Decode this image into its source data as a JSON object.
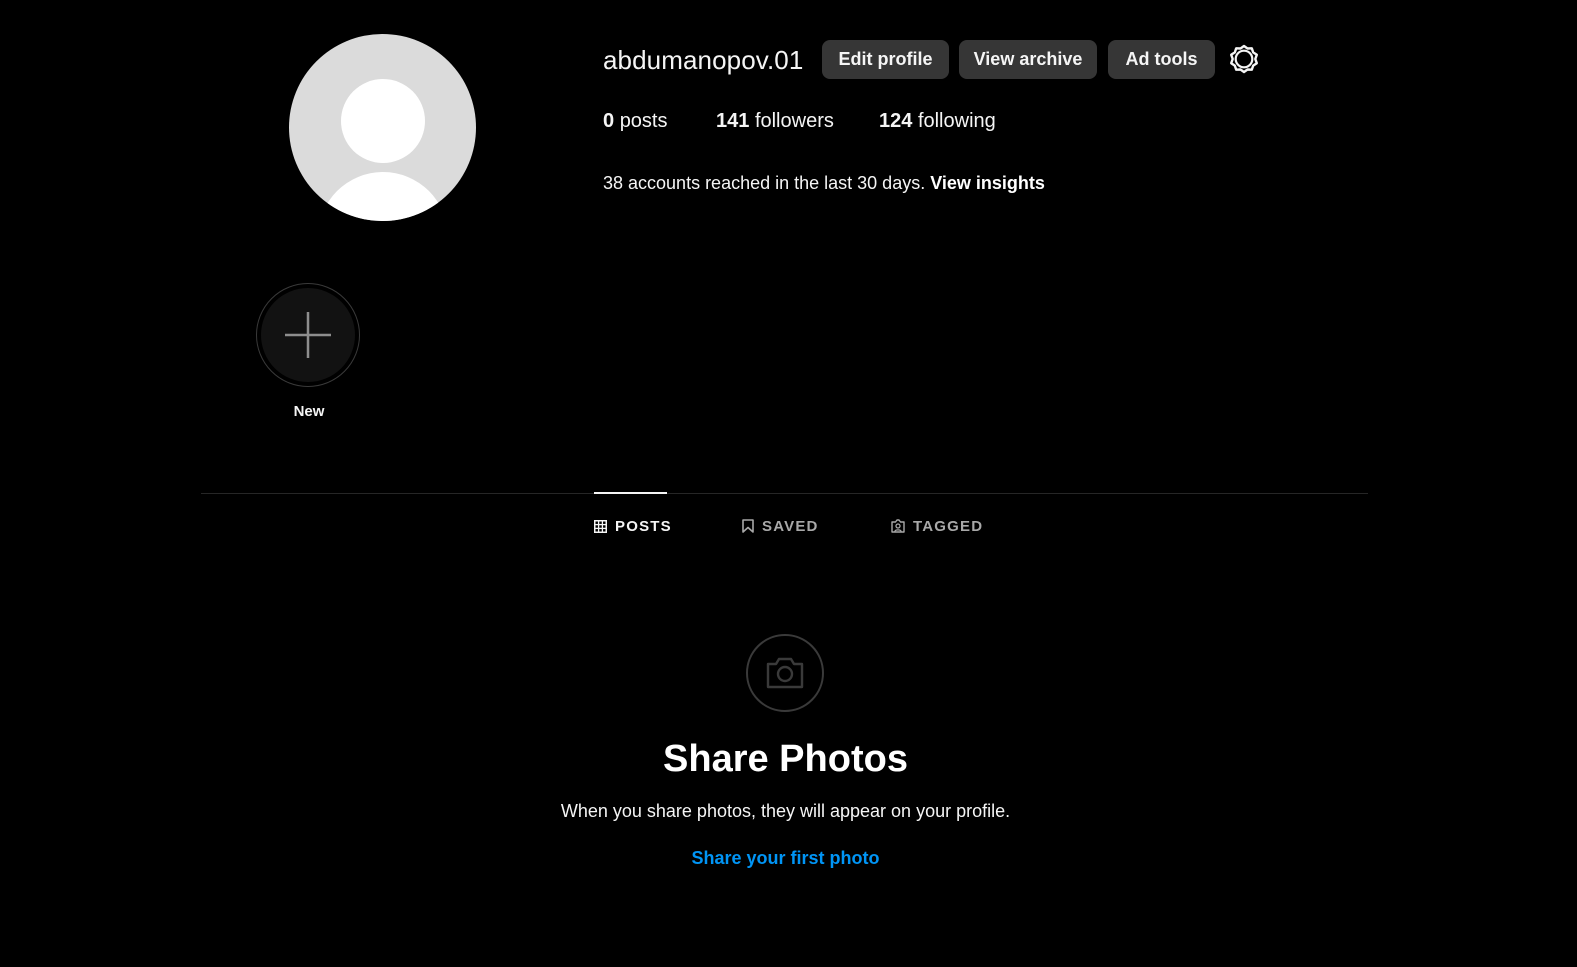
{
  "profile": {
    "username": "abdumanopov.01",
    "avatar_icon": "default-avatar-icon"
  },
  "actions": {
    "edit_profile": "Edit profile",
    "view_archive": "View archive",
    "ad_tools": "Ad tools",
    "settings_icon": "gear-icon"
  },
  "stats": {
    "posts_count": "0",
    "posts_label": "posts",
    "followers_count": "141",
    "followers_label": "followers",
    "following_count": "124",
    "following_label": "following"
  },
  "insights": {
    "reach_text": "38 accounts reached in the last 30 days.",
    "link_text": "View insights"
  },
  "highlights": {
    "new_label": "New",
    "new_icon": "plus-icon"
  },
  "tabs": [
    {
      "label": "POSTS",
      "icon": "grid-icon",
      "active": true
    },
    {
      "label": "SAVED",
      "icon": "bookmark-icon",
      "active": false
    },
    {
      "label": "TAGGED",
      "icon": "tagged-user-icon",
      "active": false
    }
  ],
  "empty_state": {
    "icon": "camera-icon",
    "title": "Share Photos",
    "subtitle": "When you share photos, they will appear on your profile.",
    "link": "Share your first photo"
  },
  "colors": {
    "background": "#000000",
    "button_bg": "#363636",
    "link_blue": "#0095f6",
    "muted_text": "#a8a8a8"
  }
}
